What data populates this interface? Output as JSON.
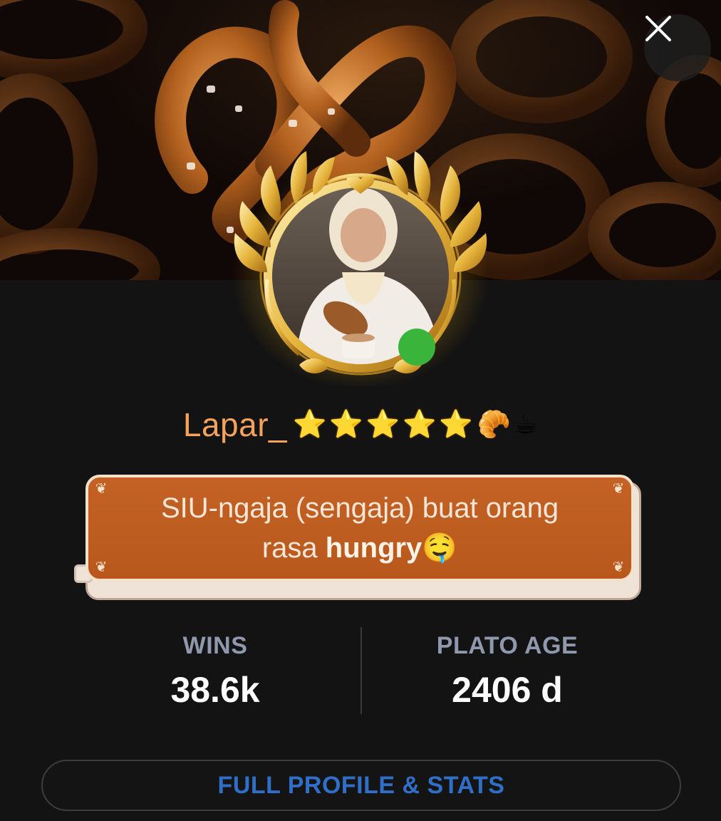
{
  "header": {
    "banner_image": "pretzels-banner",
    "close_icon": "close-icon"
  },
  "profile": {
    "avatar_image": "user-avatar-photo",
    "avatar_frame": "golden-laurel-frame",
    "online_status_color": "#3bb43b",
    "username": "Lapar_",
    "badges": [
      "⭐",
      "⭐",
      "⭐",
      "⭐",
      "⭐",
      "🥐",
      "☕"
    ],
    "bio_line1": "SIU-ngaja (sengaja) buat orang",
    "bio_line2_prefix": "rasa ",
    "bio_line2_bold": "hungry",
    "bio_emoji": "🤤"
  },
  "stats": [
    {
      "label": "WINS",
      "value": "38.6k"
    },
    {
      "label": "PLATO AGE",
      "value": "2406 d"
    }
  ],
  "actions": {
    "full_profile_label": "FULL PROFILE & STATS"
  },
  "colors": {
    "username": "#f6a25a",
    "bio_plate": "#c46225",
    "button_text": "#2f6fc7",
    "stat_label": "#8f98ad"
  }
}
